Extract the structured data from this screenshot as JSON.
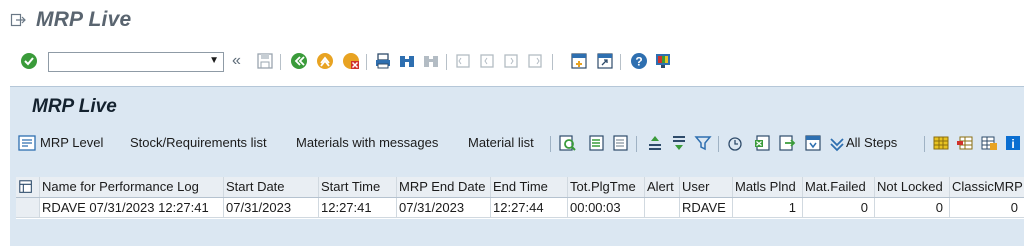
{
  "window": {
    "title": "MRP Live"
  },
  "command_field": {
    "value": "",
    "placeholder": ""
  },
  "panel": {
    "title": "MRP Live"
  },
  "app_toolbar": {
    "mrp_level": "MRP Level",
    "stock_requirements": "Stock/Requirements list",
    "materials_with_messages": "Materials with messages",
    "material_list": "Material list",
    "all_steps": "All Steps"
  },
  "table": {
    "columns": [
      "Name for Performance Log",
      "Start Date",
      "Start Time",
      "MRP End Date",
      "End Time",
      "Tot.PlgTme",
      "Alert",
      "User",
      "Matls Plnd",
      "Mat.Failed",
      "Not Locked",
      "ClassicMRP"
    ],
    "rows": [
      [
        "RDAVE 07/31/2023 12:27:41",
        "07/31/2023",
        "12:27:41",
        "07/31/2023",
        "12:27:44",
        "00:00:03",
        "",
        "RDAVE",
        "1",
        "0",
        "0",
        "0"
      ]
    ]
  },
  "colors": {
    "panel": "#dbe7f2",
    "title_gray": "#5a6570",
    "accent_blue": "#0a6ed1"
  }
}
